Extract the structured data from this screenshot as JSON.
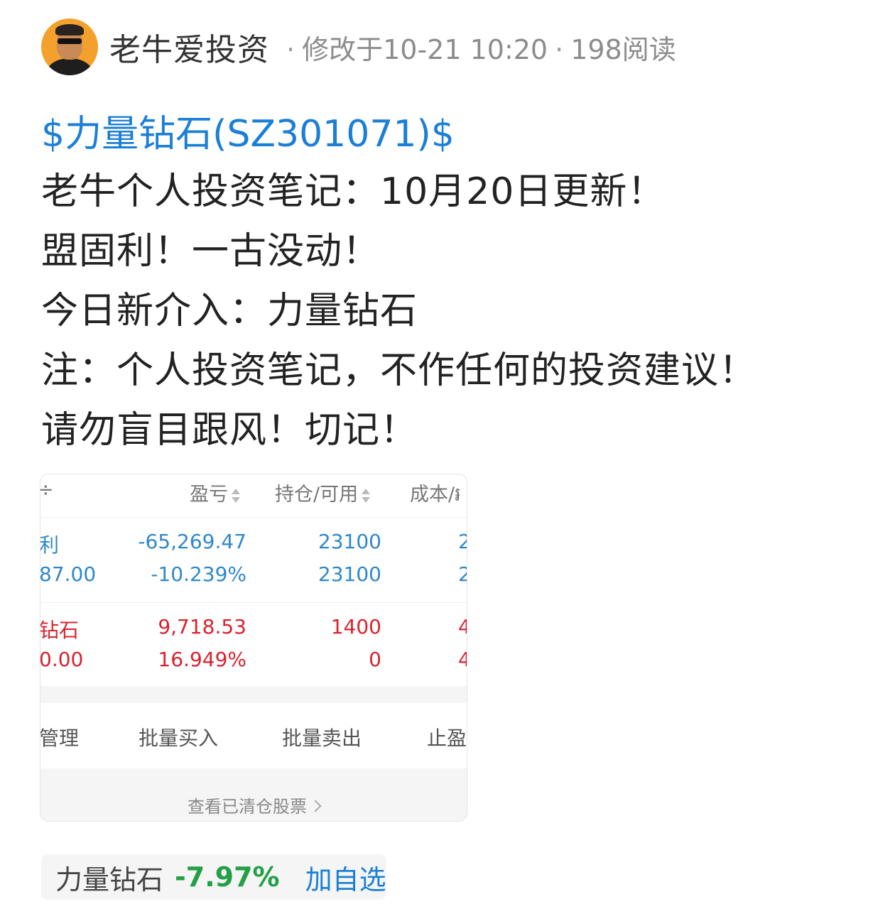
{
  "header": {
    "author": "老牛爱投资",
    "modified": "修改于10-21 10:20",
    "reads": "198阅读",
    "separator": "·"
  },
  "post": {
    "stock_link": "$力量钻石(SZ301071)$",
    "lines": [
      "老牛个人投资笔记：10月20日更新！",
      "盟固利！一古没动！",
      "今日新介入：力量钻石",
      "注：个人投资笔记，不作任何的投资建议！",
      "请勿盲目跟风！切记！"
    ]
  },
  "screenshot": {
    "headers": {
      "col0": "÷",
      "pnl": "盈亏",
      "position": "持仓/可用",
      "cost": "成本/៛"
    },
    "rows": [
      {
        "name": "利",
        "sub": "87.00",
        "pnl": "-65,269.47",
        "pnl_pct": "-10.239%",
        "hold": "23100",
        "avail": "23100",
        "cost1": "2",
        "cost2": "2",
        "color": "#2f88c9"
      },
      {
        "name": "钻石",
        "sub": "0.00",
        "pnl": "9,718.53",
        "pnl_pct": "16.949%",
        "hold": "1400",
        "avail": "0",
        "cost1": "4",
        "cost2": "4",
        "color": "#d9232e"
      }
    ],
    "actions": [
      "管理",
      "批量买入",
      "批量卖出",
      "止盈"
    ],
    "footer_link": "查看已清仓股票"
  },
  "stock_chip": {
    "name": "力量钻石",
    "change": "-7.97%",
    "add_label": "加自选",
    "change_color": "#22a046"
  }
}
